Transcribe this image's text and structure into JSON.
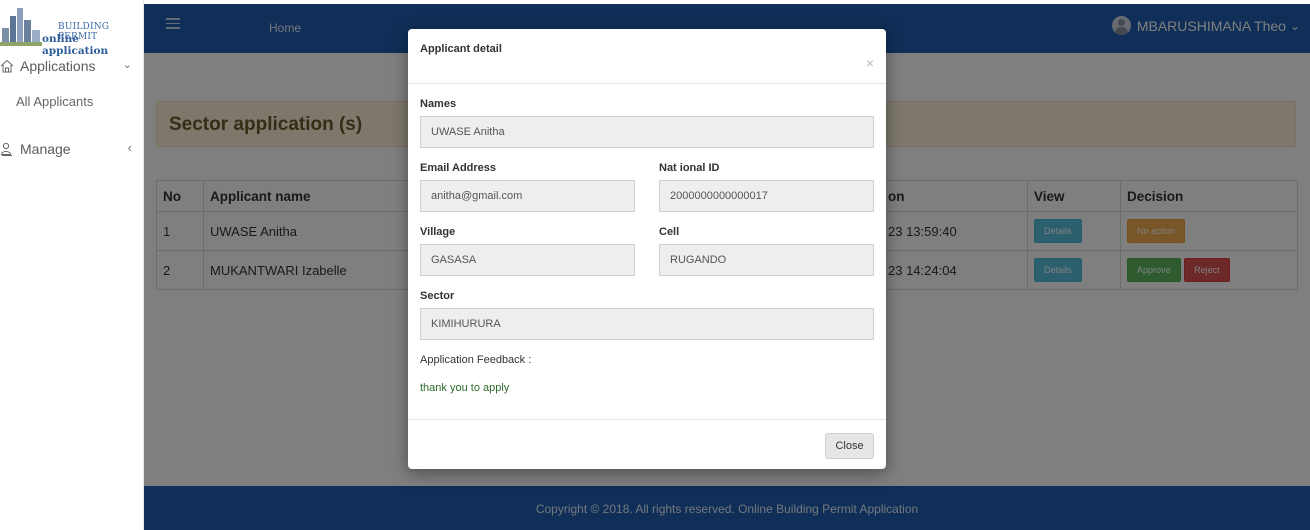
{
  "brand": {
    "line1": "BUILDING PERMIT",
    "line2": "online application"
  },
  "sidebar": {
    "items": [
      {
        "label": "Applications",
        "icon": "home-icon"
      },
      {
        "label": "Manage",
        "icon": "user-search-icon"
      }
    ],
    "subitems": [
      {
        "label": "All Applicants"
      }
    ]
  },
  "topbar": {
    "home_label": "Home",
    "user_name": "MBARUSHIMANA Theo"
  },
  "page": {
    "title": "Sector application (s)"
  },
  "table": {
    "headers": [
      "No",
      "Applicant name",
      "",
      "on",
      "View",
      "Decision"
    ],
    "rows": [
      {
        "no": "1",
        "name": "UWASE Anitha",
        "date": "23 13:59:40",
        "view": "Details",
        "decisions": [
          "No action"
        ]
      },
      {
        "no": "2",
        "name": "MUKANTWARI Izabelle",
        "date": "23 14:24:04",
        "view": "Details",
        "decisions": [
          "Approve",
          "Reject"
        ]
      }
    ]
  },
  "footer": {
    "text": "Copyright © 2018. All rights reserved. Online Building Permit Application"
  },
  "modal": {
    "title": "Applicant detail",
    "close_symbol": "×",
    "fields": {
      "names": {
        "label": "Names",
        "value": "UWASE Anitha"
      },
      "email": {
        "label": "Email Address",
        "value": "anitha@gmail.com"
      },
      "national_id": {
        "label": "Nat ional ID",
        "value": "2000000000000017"
      },
      "village": {
        "label": "Village",
        "value": "GASASA"
      },
      "cell": {
        "label": "Cell",
        "value": "RUGANDO"
      },
      "sector": {
        "label": "Sector",
        "value": "KIMIHURURA"
      }
    },
    "feedback_label": "Application Feedback :",
    "feedback_text": "thank you to apply",
    "close_label": "Close"
  },
  "colors": {
    "primary": "#1f5fb1",
    "header_bg": "#fbf1d6",
    "info": "#5bc0de",
    "warning": "#f0ad4e",
    "success": "#5cb85c",
    "danger": "#d9534f"
  }
}
